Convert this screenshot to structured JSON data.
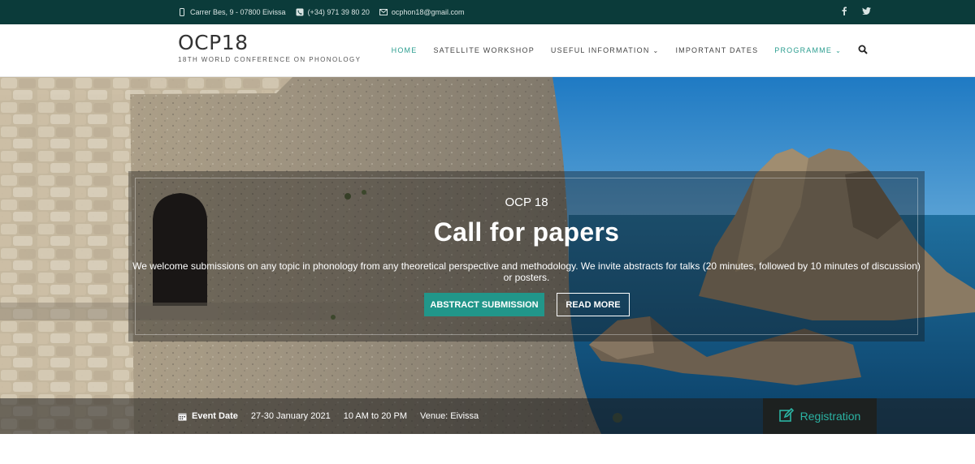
{
  "topbar": {
    "address": "Carrer Bes, 9 - 07800 Eivissa",
    "phone": "(+34) 971 39 80 20",
    "email": "ocphon18@gmail.com",
    "social": [
      "facebook-icon",
      "twitter-icon"
    ]
  },
  "header": {
    "logo": "OCP18",
    "tagline": "18TH WORLD CONFERENCE ON PHONOLOGY"
  },
  "nav": {
    "items": [
      {
        "label": "HOME",
        "active": true
      },
      {
        "label": "SATELLITE WORKSHOP"
      },
      {
        "label": "USEFUL INFORMATION",
        "dropdown": true
      },
      {
        "label": "IMPORTANT DATES"
      },
      {
        "label": "PROGRAMME",
        "dropdown": true,
        "active": true
      }
    ]
  },
  "hero": {
    "subtitle": "OCP 18",
    "title": "Call for papers",
    "description": "We welcome submissions on any topic in phonology from any theoretical perspective and methodology. We invite abstracts for talks (20 minutes, followed by 10 minutes of discussion) or posters.",
    "primary_button": "ABSTRACT SUBMISSION",
    "secondary_button": "READ MORE"
  },
  "event": {
    "label": "Event Date",
    "dates": "27-30 January 2021",
    "time": "10 AM to 20 PM",
    "venue": "Venue: Eivissa"
  },
  "registration": {
    "label": "Registration"
  },
  "colors": {
    "topbar": "#0b3b3a",
    "accent": "#21968a",
    "link_active": "#2a9d8f"
  }
}
